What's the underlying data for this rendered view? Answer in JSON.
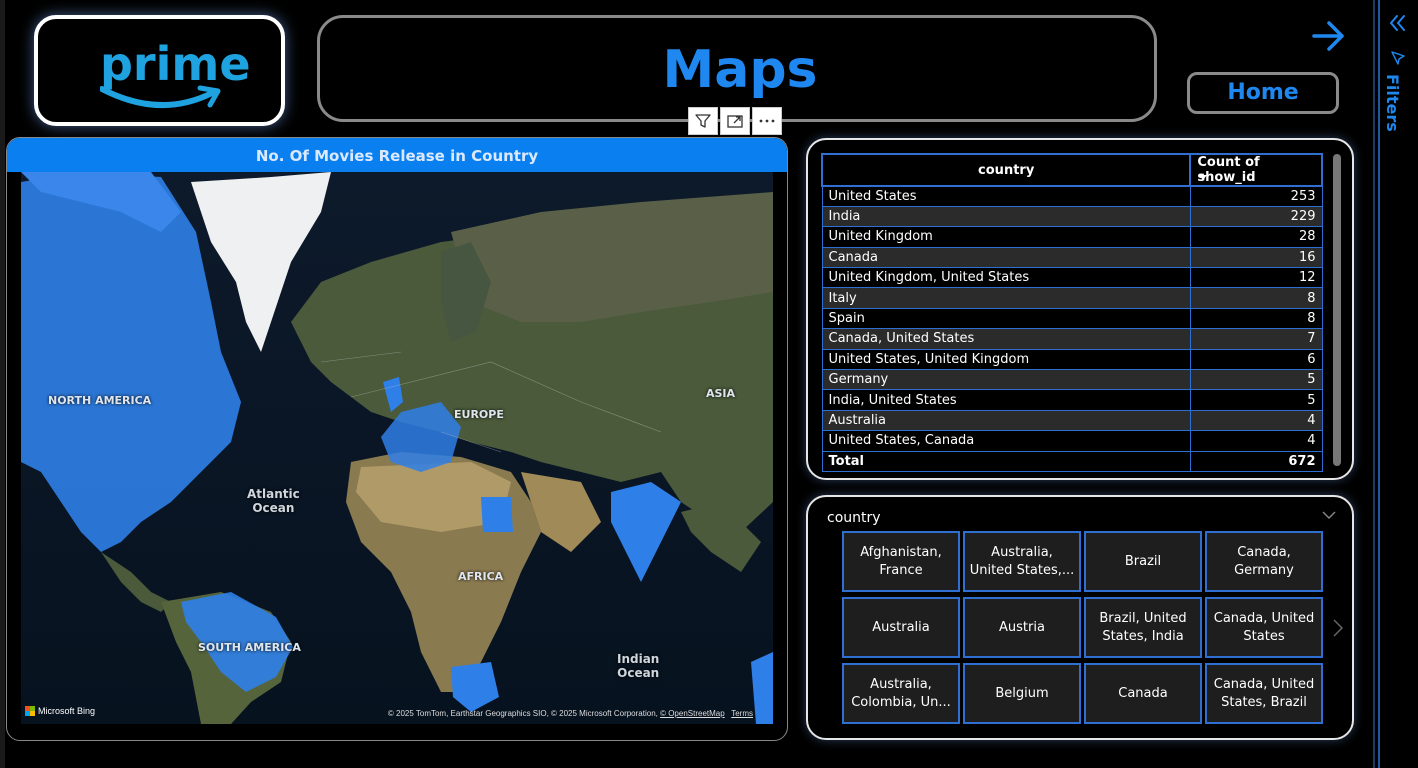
{
  "logo": {
    "text": "prime"
  },
  "header": {
    "title": "Maps"
  },
  "nav": {
    "home_label": "Home"
  },
  "filters_pane": {
    "label": "Filters"
  },
  "map_visual": {
    "title": "No. Of Movies Release in Country",
    "labels": {
      "north_america": "NORTH AMERICA",
      "europe": "EUROPE",
      "asia": "ASIA",
      "africa": "AFRICA",
      "south_america": "SOUTH AMERICA"
    },
    "oceans": {
      "atlantic_1": "Atlantic",
      "atlantic_2": "Ocean",
      "indian_1": "Indian",
      "indian_2": "Ocean"
    },
    "bing": "Microsoft Bing",
    "copyright": "© 2025 TomTom, Earthstar Geographics SIO, © 2025 Microsoft Corporation,",
    "osm_link": "© OpenStreetMap",
    "terms_link": "Terms",
    "highlight_color": "#2f7fe8"
  },
  "table": {
    "col_country": "country",
    "col_count": "Count of show_id",
    "rows": [
      {
        "country": "United States",
        "count": "253"
      },
      {
        "country": "India",
        "count": "229"
      },
      {
        "country": "United Kingdom",
        "count": "28"
      },
      {
        "country": "Canada",
        "count": "16"
      },
      {
        "country": "United Kingdom, United States",
        "count": "12"
      },
      {
        "country": "Italy",
        "count": "8"
      },
      {
        "country": "Spain",
        "count": "8"
      },
      {
        "country": "Canada, United States",
        "count": "7"
      },
      {
        "country": "United States, United Kingdom",
        "count": "6"
      },
      {
        "country": "Germany",
        "count": "5"
      },
      {
        "country": "India, United States",
        "count": "5"
      },
      {
        "country": "Australia",
        "count": "4"
      },
      {
        "country": "United States, Canada",
        "count": "4"
      }
    ],
    "total_label": "Total",
    "total_value": "672"
  },
  "slicer": {
    "title": "country",
    "tiles": [
      "Afghanistan, France",
      "Australia, United States,...",
      "Brazil",
      "Canada, Germany",
      "Australia",
      "Austria",
      "Brazil, United States, India",
      "Canada, United States",
      "Australia, Colombia, Un...",
      "Belgium",
      "Canada",
      "Canada, United States, Brazil"
    ]
  },
  "colors": {
    "accent": "#1e88f0",
    "header_bar": "#0a80f0",
    "grid_border": "#2f6fd1"
  }
}
